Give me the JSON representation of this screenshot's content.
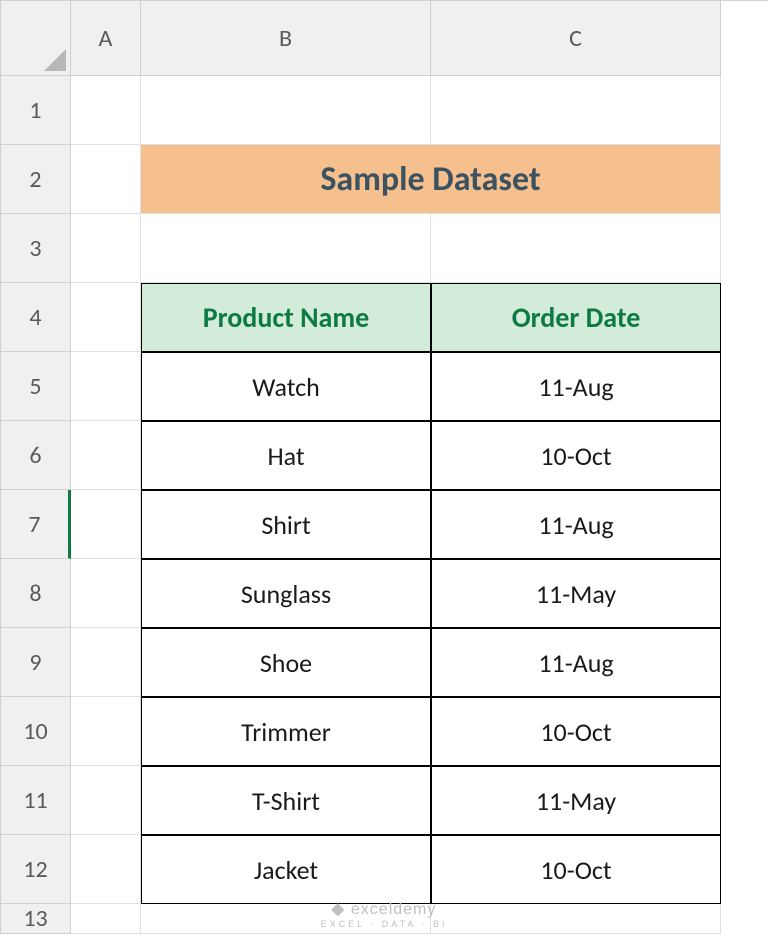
{
  "columns": [
    "A",
    "B",
    "C"
  ],
  "rows": [
    "1",
    "2",
    "3",
    "4",
    "5",
    "6",
    "7",
    "8",
    "9",
    "10",
    "11",
    "12",
    "13"
  ],
  "selectedRow": "7",
  "title": "Sample Dataset",
  "headers": {
    "b": "Product Name",
    "c": "Order Date"
  },
  "data": [
    {
      "product": "Watch",
      "date": "11-Aug"
    },
    {
      "product": "Hat",
      "date": "10-Oct"
    },
    {
      "product": "Shirt",
      "date": "11-Aug"
    },
    {
      "product": "Sunglass",
      "date": "11-May"
    },
    {
      "product": "Shoe",
      "date": "11-Aug"
    },
    {
      "product": "Trimmer",
      "date": "10-Oct"
    },
    {
      "product": "T-Shirt",
      "date": "11-May"
    },
    {
      "product": "Jacket",
      "date": "10-Oct"
    }
  ],
  "watermark": {
    "brand": "exceldemy",
    "tag": "EXCEL · DATA · BI"
  }
}
